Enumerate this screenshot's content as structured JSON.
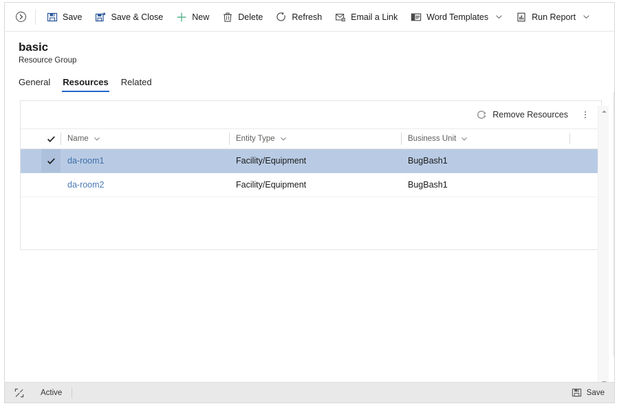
{
  "command_bar": {
    "collapse_label": "collapse-chevron",
    "buttons": [
      {
        "label": "Save",
        "icon": "save-floppy-icon",
        "caret": false
      },
      {
        "label": "Save & Close",
        "icon": "save-and-close-icon",
        "caret": false
      },
      {
        "label": "New",
        "icon": "plus-icon",
        "caret": false
      },
      {
        "label": "Delete",
        "icon": "trash-icon",
        "caret": false
      },
      {
        "label": "Refresh",
        "icon": "refresh-icon",
        "caret": false
      },
      {
        "label": "Email a Link",
        "icon": "email-link-icon",
        "caret": false
      },
      {
        "label": "Word Templates",
        "icon": "word-templates-icon",
        "caret": true
      },
      {
        "label": "Run Report",
        "icon": "run-report-icon",
        "caret": true
      }
    ]
  },
  "header": {
    "title": "basic",
    "subtitle": "Resource Group"
  },
  "tabs": [
    {
      "label": "General",
      "selected": false
    },
    {
      "label": "Resources",
      "selected": true
    },
    {
      "label": "Related",
      "selected": false
    }
  ],
  "grid_panel": {
    "commands": [
      {
        "label": "Remove Resources",
        "icon": "remove-resources-icon"
      }
    ],
    "overflow_label": "more-commands-icon",
    "columns": [
      {
        "label": "Name"
      },
      {
        "label": "Entity Type"
      },
      {
        "label": "Business Unit"
      }
    ],
    "rows": [
      {
        "selected": true,
        "name": "da-room1",
        "entity_type": "Facility/Equipment",
        "business_unit": "BugBash1"
      },
      {
        "selected": false,
        "name": "da-room2",
        "entity_type": "Facility/Equipment",
        "business_unit": "BugBash1"
      }
    ]
  },
  "status_bar": {
    "status_text": "Active",
    "save_label": "Save",
    "save_icon": "save-floppy-icon",
    "expand_icon": "expand-icon"
  },
  "colors": {
    "accent": "#2266cc",
    "link": "#4a7ab5",
    "selected_row": "#b9cbe4",
    "save_icon": "#2b579a",
    "new_icon": "#5ab38a",
    "status_bg": "#e9e9e9"
  }
}
